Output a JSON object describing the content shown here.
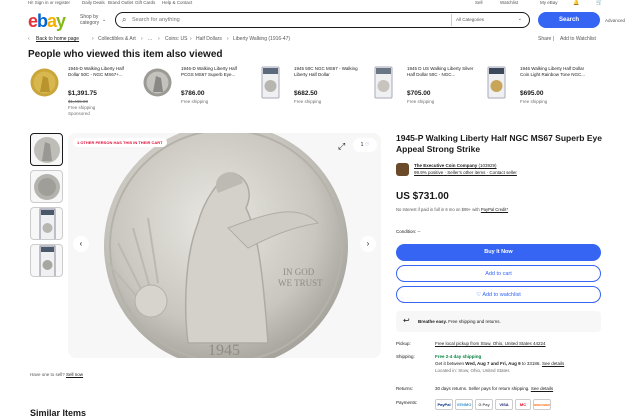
{
  "topnav": {
    "items": [
      "Hi! Sign in or register",
      "Daily Deals",
      "Brand Outlet",
      "Gift Cards",
      "Help & Contact"
    ],
    "right": [
      "Sell",
      "Watchlist",
      "My eBay"
    ]
  },
  "header": {
    "logo": {
      "e": "e",
      "b": "b",
      "a": "a",
      "y": "y"
    },
    "shop_by": "Shop by category",
    "search_placeholder": "Search for anything",
    "category": "All Categories",
    "search_button": "Search",
    "advanced": "Advanced"
  },
  "breadcrumb": {
    "back": "Back to home page",
    "items": [
      "Collectibles & Art",
      "...",
      "Coins: US",
      "Half Dollars",
      "Liberty Walking (1916-47)"
    ],
    "share": "Share",
    "add_to_watchlist": "Add to Watchlist"
  },
  "people_viewed": {
    "title": "People who viewed this item also viewed",
    "items": [
      {
        "title": "1946-D Walking Liberty Half Dollar 50C - NGC MS67+...",
        "price": "$1,391.75",
        "original": "$1,465.00",
        "shipping": "Free shipping",
        "sponsored": "Sponsored"
      },
      {
        "title": "1946-D Walking Liberty Half PCGS MS67 Superb Eye...",
        "price": "$786.00",
        "shipping": "Free shipping"
      },
      {
        "title": "1945 50C NGC MS67 - Walking Liberty Half Dollar",
        "price": "$682.50",
        "shipping": "Free shipping"
      },
      {
        "title": "1945 D US Walking Liberty Silver Half Dollar 50C - NGC...",
        "price": "$705.00",
        "shipping": "Free shipping"
      },
      {
        "title": "1946 Walking Liberty Half Dollar Coin Light Rainbow Tone NGC...",
        "price": "$695.00",
        "shipping": "Free shipping"
      }
    ]
  },
  "gallery": {
    "badge": "1 OTHER PERSON HAS THIS IN THEIR CART",
    "watch_count": "1",
    "have_one": "Have one to sell?",
    "sell_now": "Sell now"
  },
  "product": {
    "title": "1945-P Walking Liberty Half NGC MS67 Superb Eye Appeal Strong Strike",
    "seller_name": "The Executive Coin Company",
    "seller_count": "(103929)",
    "seller_positive": "99.9% positive",
    "seller_other": "Seller's other items",
    "seller_contact": "Contact seller",
    "price": "US $731.00",
    "interest_text": "No Interest if paid in full in 6 mo on $99+ with",
    "paypal_credit": "PayPal Credit*",
    "condition_label": "Condition:",
    "condition_value": "--",
    "buy_now": "Buy It Now",
    "add_to_cart": "Add to cart",
    "add_to_watchlist": "Add to watchlist",
    "breathe_bold": "Breathe easy.",
    "breathe_text": "Free shipping and returns.",
    "pickup_label": "Pickup:",
    "pickup_value": "Free local pickup from Stow, Ohio, United States 44224",
    "shipping_label": "Shipping:",
    "shipping_green": "Free 2-4 day shipping",
    "shipping_between": "Get it between",
    "shipping_dates": "Wed, Aug 7 and Fri, Aug 9",
    "shipping_to": "to 33186.",
    "see_details": "See details",
    "located": "Located in: Stow, Ohio, United States",
    "returns_label": "Returns:",
    "returns_value": "30 days returns. Seller pays for return shipping.",
    "payments_label": "Payments:",
    "payments": [
      "PayPal",
      "VENMO",
      "G Pay",
      "VISA",
      "MC",
      "DISCOVER"
    ]
  },
  "similar_title": "Similar Items",
  "colors": {
    "accent": "#3665f3",
    "green": "#05823f",
    "badge_red": "#e0103a"
  }
}
